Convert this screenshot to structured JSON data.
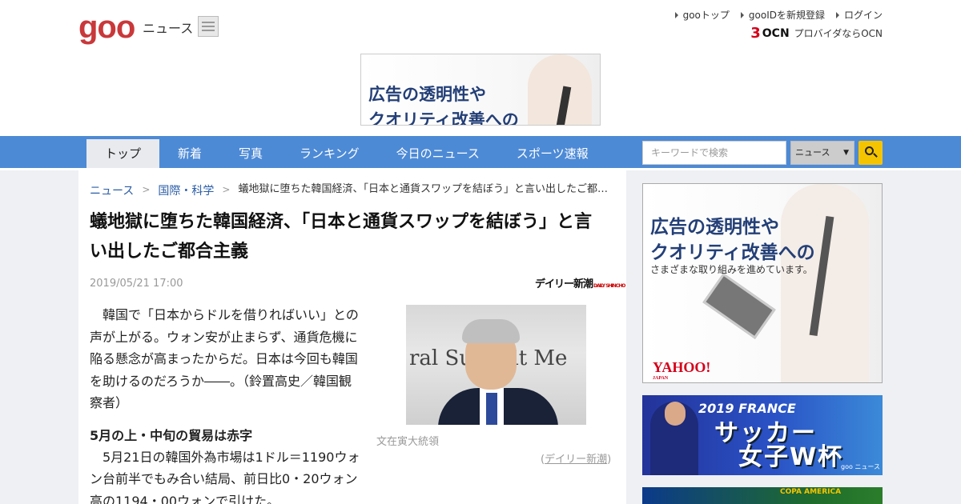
{
  "header": {
    "logo": "goo",
    "logo_sub": "ニュース",
    "links": [
      "gooトップ",
      "gooIDを新規登録",
      "ログイン"
    ],
    "ocn_logo": "OCN",
    "ocn_text": "プロバイダならOCN"
  },
  "top_ad": {
    "line1": "広告の透明性や",
    "line2": "クオリティ改善への"
  },
  "nav": {
    "items": [
      "トップ",
      "新着",
      "写真",
      "ランキング",
      "今日のニュース",
      "スポーツ速報"
    ],
    "active": "トップ",
    "search_placeholder": "キーワードで検索",
    "search_scope": "ニュース"
  },
  "breadcrumb": {
    "items": [
      "ニュース",
      "国際・科学"
    ],
    "current": "蟻地獄に堕ちた韓国経済、「日本と通貨スワップを結ぼう」と言い出したご都合主義"
  },
  "article": {
    "title": "蟻地獄に堕ちた韓国経済、「日本と通貨スワップを結ぼう」と言い出したご都合主義",
    "date": "2019/05/21 17:00",
    "source_logo": "デイリー新潮",
    "lead": "韓国で「日本からドルを借りればいい」との声が上がる。ウォン安が止まらず、通貨危機に陥る懸念が高まったからだ。日本は今回も韓国を助けるのだろうか――。（鈴置高史／韓国観察者）",
    "subheading": "5月の上・中旬の貿易は赤字",
    "paragraph2": "5月21日の韓国外為市場は1ドル＝1190ウォン台前半でもみ合い結局、前日比0・20ウォン高の1194・00ウォンで引けた。",
    "photo_caption": "文在寅大統領",
    "credit_open": "(",
    "credit_source": "デイリー新潮",
    "credit_close": ")"
  },
  "side_ad": {
    "line1": "広告の透明性や",
    "line2": "クオリティ改善への",
    "line3": "さまざまな取り組みを進めています。",
    "brand": "YAHOO!",
    "brand_sub": "JAPAN"
  },
  "soccer_ad": {
    "line1": "2019 FRANCE",
    "line2": "サッカー",
    "line3": "女子W杯",
    "mark": "goo ニュース"
  },
  "copa_ad": {
    "text": "COPA AMERICA"
  },
  "colors": {
    "nav_bg": "#4d8ad6",
    "logo_red": "#c9383a",
    "search_button": "#f5c400",
    "link_blue": "#2a5ca6"
  }
}
